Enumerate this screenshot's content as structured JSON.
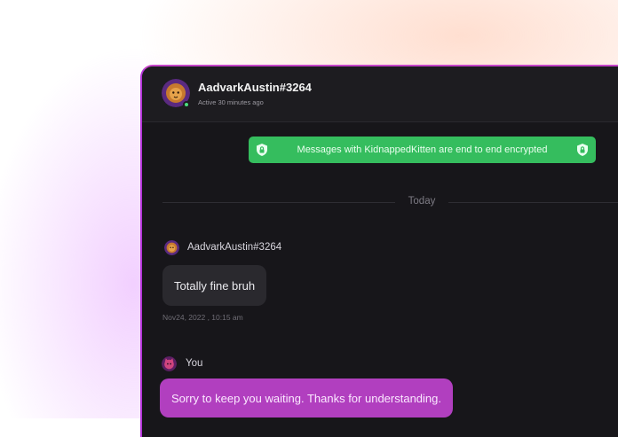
{
  "chat": {
    "contact_name": "AadvarkAustin#3264",
    "contact_status": "Active 30 minutes ago",
    "contact_avatar_icon": "lion-avatar-icon",
    "online_indicator_color": "#4ade80"
  },
  "encryption_banner": {
    "text": "Messages with KidnappedKitten are end to end encrypted",
    "icon": "shield-lock-icon",
    "color": "#35bd5e"
  },
  "date_divider": "Today",
  "messages": [
    {
      "sender": "AadvarkAustin#3264",
      "text": "Totally fine bruh",
      "timestamp": "Nov24, 2022 , 10:15 am",
      "direction": "incoming"
    },
    {
      "sender": "You",
      "text": "Sorry to keep you waiting. Thanks for understanding.",
      "direction": "outgoing",
      "bubble_color": "#b13fbf"
    }
  ]
}
